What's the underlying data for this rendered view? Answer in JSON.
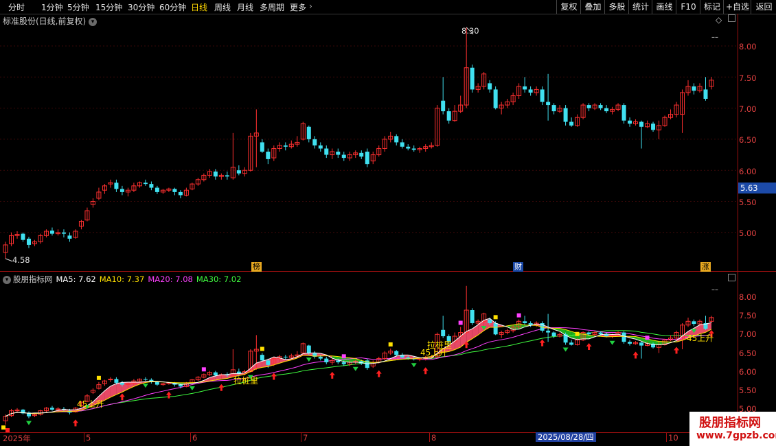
{
  "toolbar": {
    "timeframes": [
      "分时",
      "1分钟",
      "5分钟",
      "15分钟",
      "30分钟",
      "60分钟",
      "日线",
      "周线",
      "月线",
      "多周期",
      "更多"
    ],
    "active_timeframe": "日线",
    "buttons": [
      "复权",
      "叠加",
      "多股",
      "统计",
      "画线",
      "F10",
      "标记",
      "+自选",
      "返回"
    ]
  },
  "stock_title": "标准股份(日线,前复权)",
  "indicator": {
    "name": "股朋指标网",
    "ma5": "MA5: 7.62",
    "ma10": "MA10: 7.37",
    "ma20": "MA20: 7.08",
    "ma30": "MA30: 7.02"
  },
  "price_axis": {
    "top_ticks": [
      "8.00",
      "7.50",
      "7.00",
      "6.50",
      "6.00",
      "5.50",
      "5.00"
    ],
    "bottom_ticks": [
      "8.00",
      "7.50",
      "7.00",
      "6.50",
      "6.00",
      "5.50",
      "5.00"
    ],
    "current_price": "5.63"
  },
  "annotations": {
    "high": "8.30",
    "low": "4.58",
    "event_bang": "榜",
    "event_cai": "财",
    "event_last": "涨",
    "signal_upslope": "45上升",
    "signal_pile": "拉桩里"
  },
  "dates": {
    "year_label": "2025年",
    "months": [
      "5",
      "6",
      "7",
      "8",
      "10"
    ],
    "cursor_date": "2025/08/28/四"
  },
  "watermark": {
    "title": "股朋指标网",
    "url": "www.7gpzb.com"
  },
  "colors": {
    "up": "#ff3030",
    "down": "#40e0f0",
    "ma5": "#ffffff",
    "ma10": "#ffe000",
    "ma20": "#ff40ff",
    "ma30": "#40ff40",
    "axis": "#a01010"
  },
  "chart_data": {
    "type": "candlestick",
    "ylim": [
      4.58,
      8.3
    ],
    "candles": [
      {
        "o": 4.68,
        "c": 4.8,
        "h": 4.85,
        "l": 4.58
      },
      {
        "o": 4.82,
        "c": 4.95,
        "h": 5.0,
        "l": 4.78
      },
      {
        "o": 4.95,
        "c": 4.97,
        "h": 5.02,
        "l": 4.9
      },
      {
        "o": 4.98,
        "c": 4.88,
        "h": 5.0,
        "l": 4.85
      },
      {
        "o": 4.9,
        "c": 4.8,
        "h": 4.93,
        "l": 4.75
      },
      {
        "o": 4.82,
        "c": 4.85,
        "h": 4.88,
        "l": 4.78
      },
      {
        "o": 4.85,
        "c": 4.95,
        "h": 4.98,
        "l": 4.82
      },
      {
        "o": 4.95,
        "c": 5.02,
        "h": 5.05,
        "l": 4.92
      },
      {
        "o": 5.03,
        "c": 4.98,
        "h": 5.08,
        "l": 4.95
      },
      {
        "o": 4.98,
        "c": 5.0,
        "h": 5.05,
        "l": 4.95
      },
      {
        "o": 5.0,
        "c": 4.98,
        "h": 5.05,
        "l": 4.92
      },
      {
        "o": 4.95,
        "c": 4.9,
        "h": 5.0,
        "l": 4.85
      },
      {
        "o": 4.92,
        "c": 5.02,
        "h": 5.05,
        "l": 4.9
      },
      {
        "o": 5.1,
        "c": 5.18,
        "h": 5.2,
        "l": 5.05
      },
      {
        "o": 5.2,
        "c": 5.35,
        "h": 5.4,
        "l": 5.18
      },
      {
        "o": 5.45,
        "c": 5.5,
        "h": 5.55,
        "l": 5.4
      },
      {
        "o": 5.55,
        "c": 5.65,
        "h": 5.72,
        "l": 5.52
      },
      {
        "o": 5.68,
        "c": 5.75,
        "h": 5.78,
        "l": 5.62
      },
      {
        "o": 5.78,
        "c": 5.8,
        "h": 5.85,
        "l": 5.72
      },
      {
        "o": 5.8,
        "c": 5.7,
        "h": 5.85,
        "l": 5.65
      },
      {
        "o": 5.7,
        "c": 5.65,
        "h": 5.75,
        "l": 5.6
      },
      {
        "o": 5.65,
        "c": 5.68,
        "h": 5.72,
        "l": 5.58
      },
      {
        "o": 5.68,
        "c": 5.75,
        "h": 5.8,
        "l": 5.65
      },
      {
        "o": 5.75,
        "c": 5.8,
        "h": 5.82,
        "l": 5.72
      },
      {
        "o": 5.8,
        "c": 5.78,
        "h": 5.85,
        "l": 5.75
      },
      {
        "o": 5.78,
        "c": 5.72,
        "h": 5.82,
        "l": 5.68
      },
      {
        "o": 5.72,
        "c": 5.65,
        "h": 5.75,
        "l": 5.62
      },
      {
        "o": 5.65,
        "c": 5.68,
        "h": 5.7,
        "l": 5.62
      },
      {
        "o": 5.68,
        "c": 5.7,
        "h": 5.72,
        "l": 5.65
      },
      {
        "o": 5.7,
        "c": 5.65,
        "h": 5.72,
        "l": 5.6
      },
      {
        "o": 5.65,
        "c": 5.6,
        "h": 5.68,
        "l": 5.55
      },
      {
        "o": 5.6,
        "c": 5.68,
        "h": 5.72,
        "l": 5.58
      },
      {
        "o": 5.7,
        "c": 5.78,
        "h": 5.8,
        "l": 5.68
      },
      {
        "o": 5.78,
        "c": 5.85,
        "h": 5.88,
        "l": 5.75
      },
      {
        "o": 5.85,
        "c": 5.92,
        "h": 5.95,
        "l": 5.82
      },
      {
        "o": 5.92,
        "c": 5.98,
        "h": 6.02,
        "l": 5.88
      },
      {
        "o": 5.98,
        "c": 5.9,
        "h": 6.02,
        "l": 5.85
      },
      {
        "o": 5.9,
        "c": 5.92,
        "h": 5.95,
        "l": 5.85
      },
      {
        "o": 5.92,
        "c": 5.9,
        "h": 5.98,
        "l": 5.85
      },
      {
        "o": 5.88,
        "c": 6.05,
        "h": 6.6,
        "l": 5.85
      },
      {
        "o": 6.0,
        "c": 5.95,
        "h": 6.08,
        "l": 5.92
      },
      {
        "o": 5.95,
        "c": 6.0,
        "h": 6.05,
        "l": 5.9
      },
      {
        "o": 6.0,
        "c": 6.55,
        "h": 6.6,
        "l": 5.98
      },
      {
        "o": 6.55,
        "c": 6.6,
        "h": 6.98,
        "l": 6.05
      },
      {
        "o": 6.45,
        "c": 6.3,
        "h": 6.5,
        "l": 6.28
      },
      {
        "o": 6.3,
        "c": 6.18,
        "h": 6.35,
        "l": 6.1
      },
      {
        "o": 6.2,
        "c": 6.35,
        "h": 6.4,
        "l": 6.15
      },
      {
        "o": 6.35,
        "c": 6.4,
        "h": 6.45,
        "l": 6.3
      },
      {
        "o": 6.4,
        "c": 6.38,
        "h": 6.45,
        "l": 6.32
      },
      {
        "o": 6.38,
        "c": 6.42,
        "h": 6.48,
        "l": 6.35
      },
      {
        "o": 6.42,
        "c": 6.45,
        "h": 6.55,
        "l": 6.38
      },
      {
        "o": 6.5,
        "c": 6.75,
        "h": 6.78,
        "l": 6.48
      },
      {
        "o": 6.7,
        "c": 6.5,
        "h": 6.72,
        "l": 6.45
      },
      {
        "o": 6.5,
        "c": 6.4,
        "h": 6.55,
        "l": 6.35
      },
      {
        "o": 6.4,
        "c": 6.35,
        "h": 6.45,
        "l": 6.3
      },
      {
        "o": 6.35,
        "c": 6.25,
        "h": 6.4,
        "l": 6.2
      },
      {
        "o": 6.25,
        "c": 6.3,
        "h": 6.35,
        "l": 6.18
      },
      {
        "o": 6.3,
        "c": 6.25,
        "h": 6.35,
        "l": 6.2
      },
      {
        "o": 6.25,
        "c": 6.2,
        "h": 6.3,
        "l": 6.15
      },
      {
        "o": 6.2,
        "c": 6.25,
        "h": 6.3,
        "l": 6.15
      },
      {
        "o": 6.25,
        "c": 6.28,
        "h": 6.32,
        "l": 6.2
      },
      {
        "o": 6.28,
        "c": 6.22,
        "h": 6.32,
        "l": 6.18
      },
      {
        "o": 6.3,
        "c": 6.1,
        "h": 6.35,
        "l": 6.05
      },
      {
        "o": 6.15,
        "c": 6.25,
        "h": 6.3,
        "l": 6.1
      },
      {
        "o": 6.25,
        "c": 6.35,
        "h": 6.4,
        "l": 6.22
      },
      {
        "o": 6.35,
        "c": 6.5,
        "h": 6.55,
        "l": 6.3
      },
      {
        "o": 6.5,
        "c": 6.55,
        "h": 6.62,
        "l": 6.45
      },
      {
        "o": 6.55,
        "c": 6.45,
        "h": 6.58,
        "l": 6.4
      },
      {
        "o": 6.45,
        "c": 6.38,
        "h": 6.5,
        "l": 6.35
      },
      {
        "o": 6.38,
        "c": 6.35,
        "h": 6.42,
        "l": 6.32
      },
      {
        "o": 6.35,
        "c": 6.33,
        "h": 6.4,
        "l": 6.3
      },
      {
        "o": 6.33,
        "c": 6.35,
        "h": 6.38,
        "l": 6.28
      },
      {
        "o": 6.35,
        "c": 6.38,
        "h": 6.42,
        "l": 6.3
      },
      {
        "o": 6.38,
        "c": 6.4,
        "h": 6.45,
        "l": 6.35
      },
      {
        "o": 6.4,
        "c": 7.0,
        "h": 7.05,
        "l": 6.38
      },
      {
        "o": 7.12,
        "c": 6.95,
        "h": 7.5,
        "l": 6.9
      },
      {
        "o": 6.95,
        "c": 6.8,
        "h": 7.0,
        "l": 6.75
      },
      {
        "o": 6.8,
        "c": 6.95,
        "h": 7.05,
        "l": 6.78
      },
      {
        "o": 6.95,
        "c": 7.05,
        "h": 7.2,
        "l": 6.92
      },
      {
        "o": 7.05,
        "c": 7.65,
        "h": 8.3,
        "l": 7.0
      },
      {
        "o": 7.65,
        "c": 7.3,
        "h": 7.7,
        "l": 7.25
      },
      {
        "o": 7.3,
        "c": 7.35,
        "h": 7.4,
        "l": 7.25
      },
      {
        "o": 7.35,
        "c": 7.55,
        "h": 7.58,
        "l": 7.3
      },
      {
        "o": 7.4,
        "c": 7.3,
        "h": 7.45,
        "l": 7.25
      },
      {
        "o": 7.3,
        "c": 7.0,
        "h": 7.35,
        "l": 6.98
      },
      {
        "o": 7.0,
        "c": 7.05,
        "h": 7.1,
        "l": 6.9
      },
      {
        "o": 7.05,
        "c": 7.1,
        "h": 7.15,
        "l": 7.0
      },
      {
        "o": 7.1,
        "c": 7.2,
        "h": 7.25,
        "l": 7.05
      },
      {
        "o": 7.2,
        "c": 7.35,
        "h": 7.4,
        "l": 7.15
      },
      {
        "o": 7.35,
        "c": 7.3,
        "h": 7.5,
        "l": 7.25
      },
      {
        "o": 7.3,
        "c": 7.25,
        "h": 7.35,
        "l": 7.2
      },
      {
        "o": 7.25,
        "c": 7.3,
        "h": 7.35,
        "l": 7.2
      },
      {
        "o": 7.3,
        "c": 7.1,
        "h": 7.35,
        "l": 7.05
      },
      {
        "o": 7.1,
        "c": 7.05,
        "h": 7.55,
        "l": 6.8
      },
      {
        "o": 7.05,
        "c": 6.95,
        "h": 7.08,
        "l": 6.9
      },
      {
        "o": 6.95,
        "c": 7.0,
        "h": 7.05,
        "l": 6.92
      },
      {
        "o": 7.0,
        "c": 6.78,
        "h": 7.05,
        "l": 6.72
      },
      {
        "o": 6.78,
        "c": 6.72,
        "h": 6.85,
        "l": 6.7
      },
      {
        "o": 6.72,
        "c": 6.85,
        "h": 6.9,
        "l": 6.7
      },
      {
        "o": 6.85,
        "c": 7.05,
        "h": 7.08,
        "l": 6.82
      },
      {
        "o": 7.05,
        "c": 7.0,
        "h": 7.08,
        "l": 6.95
      },
      {
        "o": 7.0,
        "c": 7.05,
        "h": 7.08,
        "l": 6.97
      },
      {
        "o": 7.05,
        "c": 7.0,
        "h": 7.08,
        "l": 6.97
      },
      {
        "o": 7.0,
        "c": 6.95,
        "h": 7.05,
        "l": 6.92
      },
      {
        "o": 6.95,
        "c": 6.98,
        "h": 7.02,
        "l": 6.9
      },
      {
        "o": 6.98,
        "c": 7.05,
        "h": 7.08,
        "l": 6.95
      },
      {
        "o": 7.05,
        "c": 6.8,
        "h": 7.08,
        "l": 6.75
      },
      {
        "o": 6.8,
        "c": 6.75,
        "h": 6.85,
        "l": 6.7
      },
      {
        "o": 6.75,
        "c": 6.78,
        "h": 6.82,
        "l": 6.72
      },
      {
        "o": 6.78,
        "c": 6.7,
        "h": 6.8,
        "l": 6.35
      },
      {
        "o": 6.7,
        "c": 6.75,
        "h": 6.8,
        "l": 6.68
      },
      {
        "o": 6.75,
        "c": 6.65,
        "h": 6.78,
        "l": 6.62
      },
      {
        "o": 6.65,
        "c": 6.72,
        "h": 6.8,
        "l": 6.5
      },
      {
        "o": 6.72,
        "c": 6.85,
        "h": 6.88,
        "l": 6.7
      },
      {
        "o": 6.85,
        "c": 6.9,
        "h": 6.98,
        "l": 6.82
      },
      {
        "o": 6.9,
        "c": 7.05,
        "h": 7.1,
        "l": 6.85
      },
      {
        "o": 6.9,
        "c": 7.25,
        "h": 7.3,
        "l": 6.6
      },
      {
        "o": 7.25,
        "c": 7.35,
        "h": 7.45,
        "l": 7.2
      },
      {
        "o": 7.35,
        "c": 7.28,
        "h": 7.4,
        "l": 7.22
      },
      {
        "o": 7.28,
        "c": 7.35,
        "h": 7.4,
        "l": 7.25
      },
      {
        "o": 7.3,
        "c": 7.15,
        "h": 7.5,
        "l": 7.12
      },
      {
        "o": 7.35,
        "c": 7.45,
        "h": 7.5,
        "l": 7.3
      }
    ]
  }
}
